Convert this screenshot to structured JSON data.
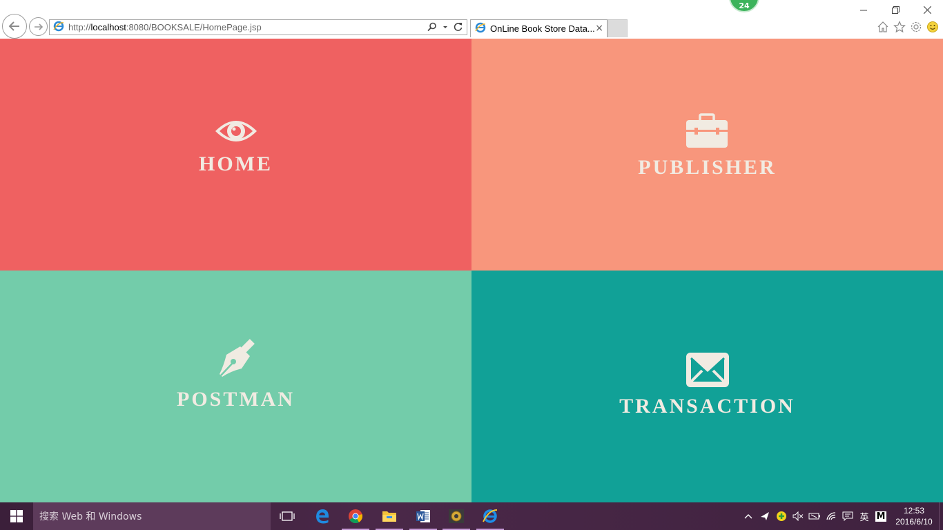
{
  "browser": {
    "url_prefix": "http://",
    "url_host": "localhost",
    "url_rest": ":8080/BOOKSALE/HomePage.jsp",
    "tab_title": "OnLine Book Store Data...",
    "tab_close": "×",
    "notification_count": "24"
  },
  "tiles": [
    {
      "label": "HOME",
      "icon": "eye-icon",
      "color": "#ef6161"
    },
    {
      "label": "PUBLISHER",
      "icon": "briefcase-icon",
      "color": "#f8967c"
    },
    {
      "label": "POSTMAN",
      "icon": "pen-nib-icon",
      "color": "#73ccaa"
    },
    {
      "label": "TRANSACTION",
      "icon": "envelope-icon",
      "color": "#11a197"
    }
  ],
  "taskbar": {
    "search_placeholder": "搜索 Web 和 Windows",
    "ime_label": "英",
    "ime_mode": "M",
    "clock_time": "12:53",
    "clock_date": "2016/6/10"
  }
}
